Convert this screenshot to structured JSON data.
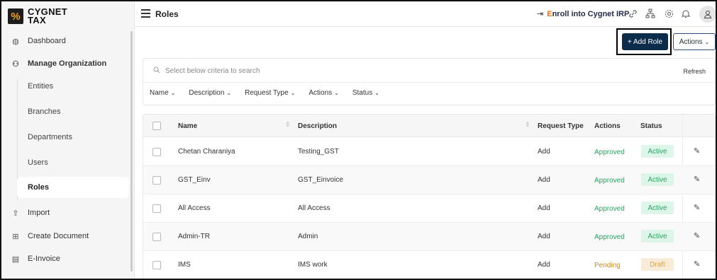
{
  "brand": {
    "line1": "CYGNET",
    "line2": "TAX",
    "mark": "%"
  },
  "sidebar": {
    "items": [
      {
        "label": "Dashboard",
        "icon": "gauge-icon",
        "glyph": "◍"
      },
      {
        "label": "Manage Organization",
        "icon": "organization-icon",
        "glyph": "⚇"
      },
      {
        "label": "Import",
        "icon": "import-icon",
        "glyph": "⇪"
      },
      {
        "label": "Create Document",
        "icon": "document-plus-icon",
        "glyph": "⊞"
      },
      {
        "label": "E-Invoice",
        "icon": "invoice-icon",
        "glyph": "▤"
      }
    ],
    "subitems": [
      "Entities",
      "Branches",
      "Departments",
      "Users",
      "Roles"
    ],
    "active_subitem": "Roles"
  },
  "header": {
    "title": "Roles",
    "enroll_prefix": "",
    "enroll_e": "E",
    "enroll_rest": "nroll into Cygnet IRP",
    "icons": [
      "link-icon",
      "sitemap-icon",
      "settings-icon",
      "bell-icon",
      "user-icon"
    ]
  },
  "toolbar": {
    "add_label": "+ Add Role",
    "actions_label": "Actions"
  },
  "filter": {
    "search_placeholder": "Select below criteria to search",
    "refresh_label": "Refresh",
    "filters": [
      "Name",
      "Description",
      "Request Type",
      "Actions",
      "Status"
    ]
  },
  "table": {
    "columns": [
      "Name",
      "Description",
      "Request Type",
      "Actions",
      "Status"
    ],
    "rows": [
      {
        "name": "Chetan Charaniya",
        "description": "Testing_GST",
        "request_type": "Add",
        "action": "Approved",
        "status": "Active"
      },
      {
        "name": "GST_Einv",
        "description": "GST_Einvoice",
        "request_type": "Add",
        "action": "Approved",
        "status": "Active"
      },
      {
        "name": "All Access",
        "description": "All Access",
        "request_type": "Add",
        "action": "Approved",
        "status": "Active"
      },
      {
        "name": "Admin-TR",
        "description": "Admin",
        "request_type": "Add",
        "action": "Approved",
        "status": "Active"
      },
      {
        "name": "IMS",
        "description": "IMS work",
        "request_type": "Add",
        "action": "Pending",
        "status": "Draft"
      }
    ]
  },
  "colors": {
    "primary": "#0c2c4c",
    "approved": "#26a55e",
    "pending": "#c98a1c",
    "brand_accent": "#e5731d"
  }
}
